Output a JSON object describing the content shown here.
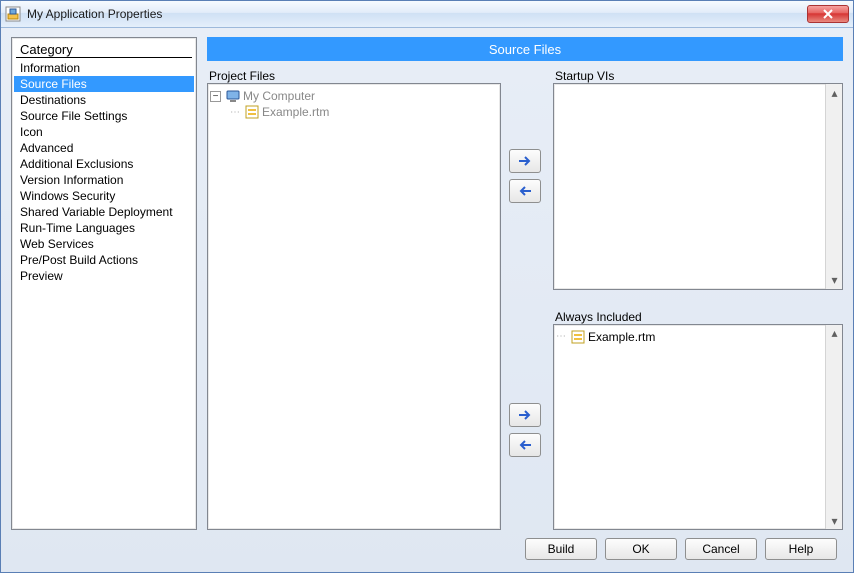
{
  "window": {
    "title": "My Application Properties"
  },
  "category": {
    "header": "Category",
    "items": [
      "Information",
      "Source Files",
      "Destinations",
      "Source File Settings",
      "Icon",
      "Advanced",
      "Additional Exclusions",
      "Version Information",
      "Windows Security",
      "Shared Variable Deployment",
      "Run-Time Languages",
      "Web Services",
      "Pre/Post Build Actions",
      "Preview"
    ],
    "selected_index": 1
  },
  "section_title": "Source Files",
  "project_files": {
    "label": "Project Files",
    "root": "My Computer",
    "child": "Example.rtm"
  },
  "startup_vis": {
    "label": "Startup VIs"
  },
  "always_included": {
    "label": "Always Included",
    "item": "Example.rtm"
  },
  "buttons": {
    "build": "Build",
    "ok": "OK",
    "cancel": "Cancel",
    "help": "Help"
  }
}
